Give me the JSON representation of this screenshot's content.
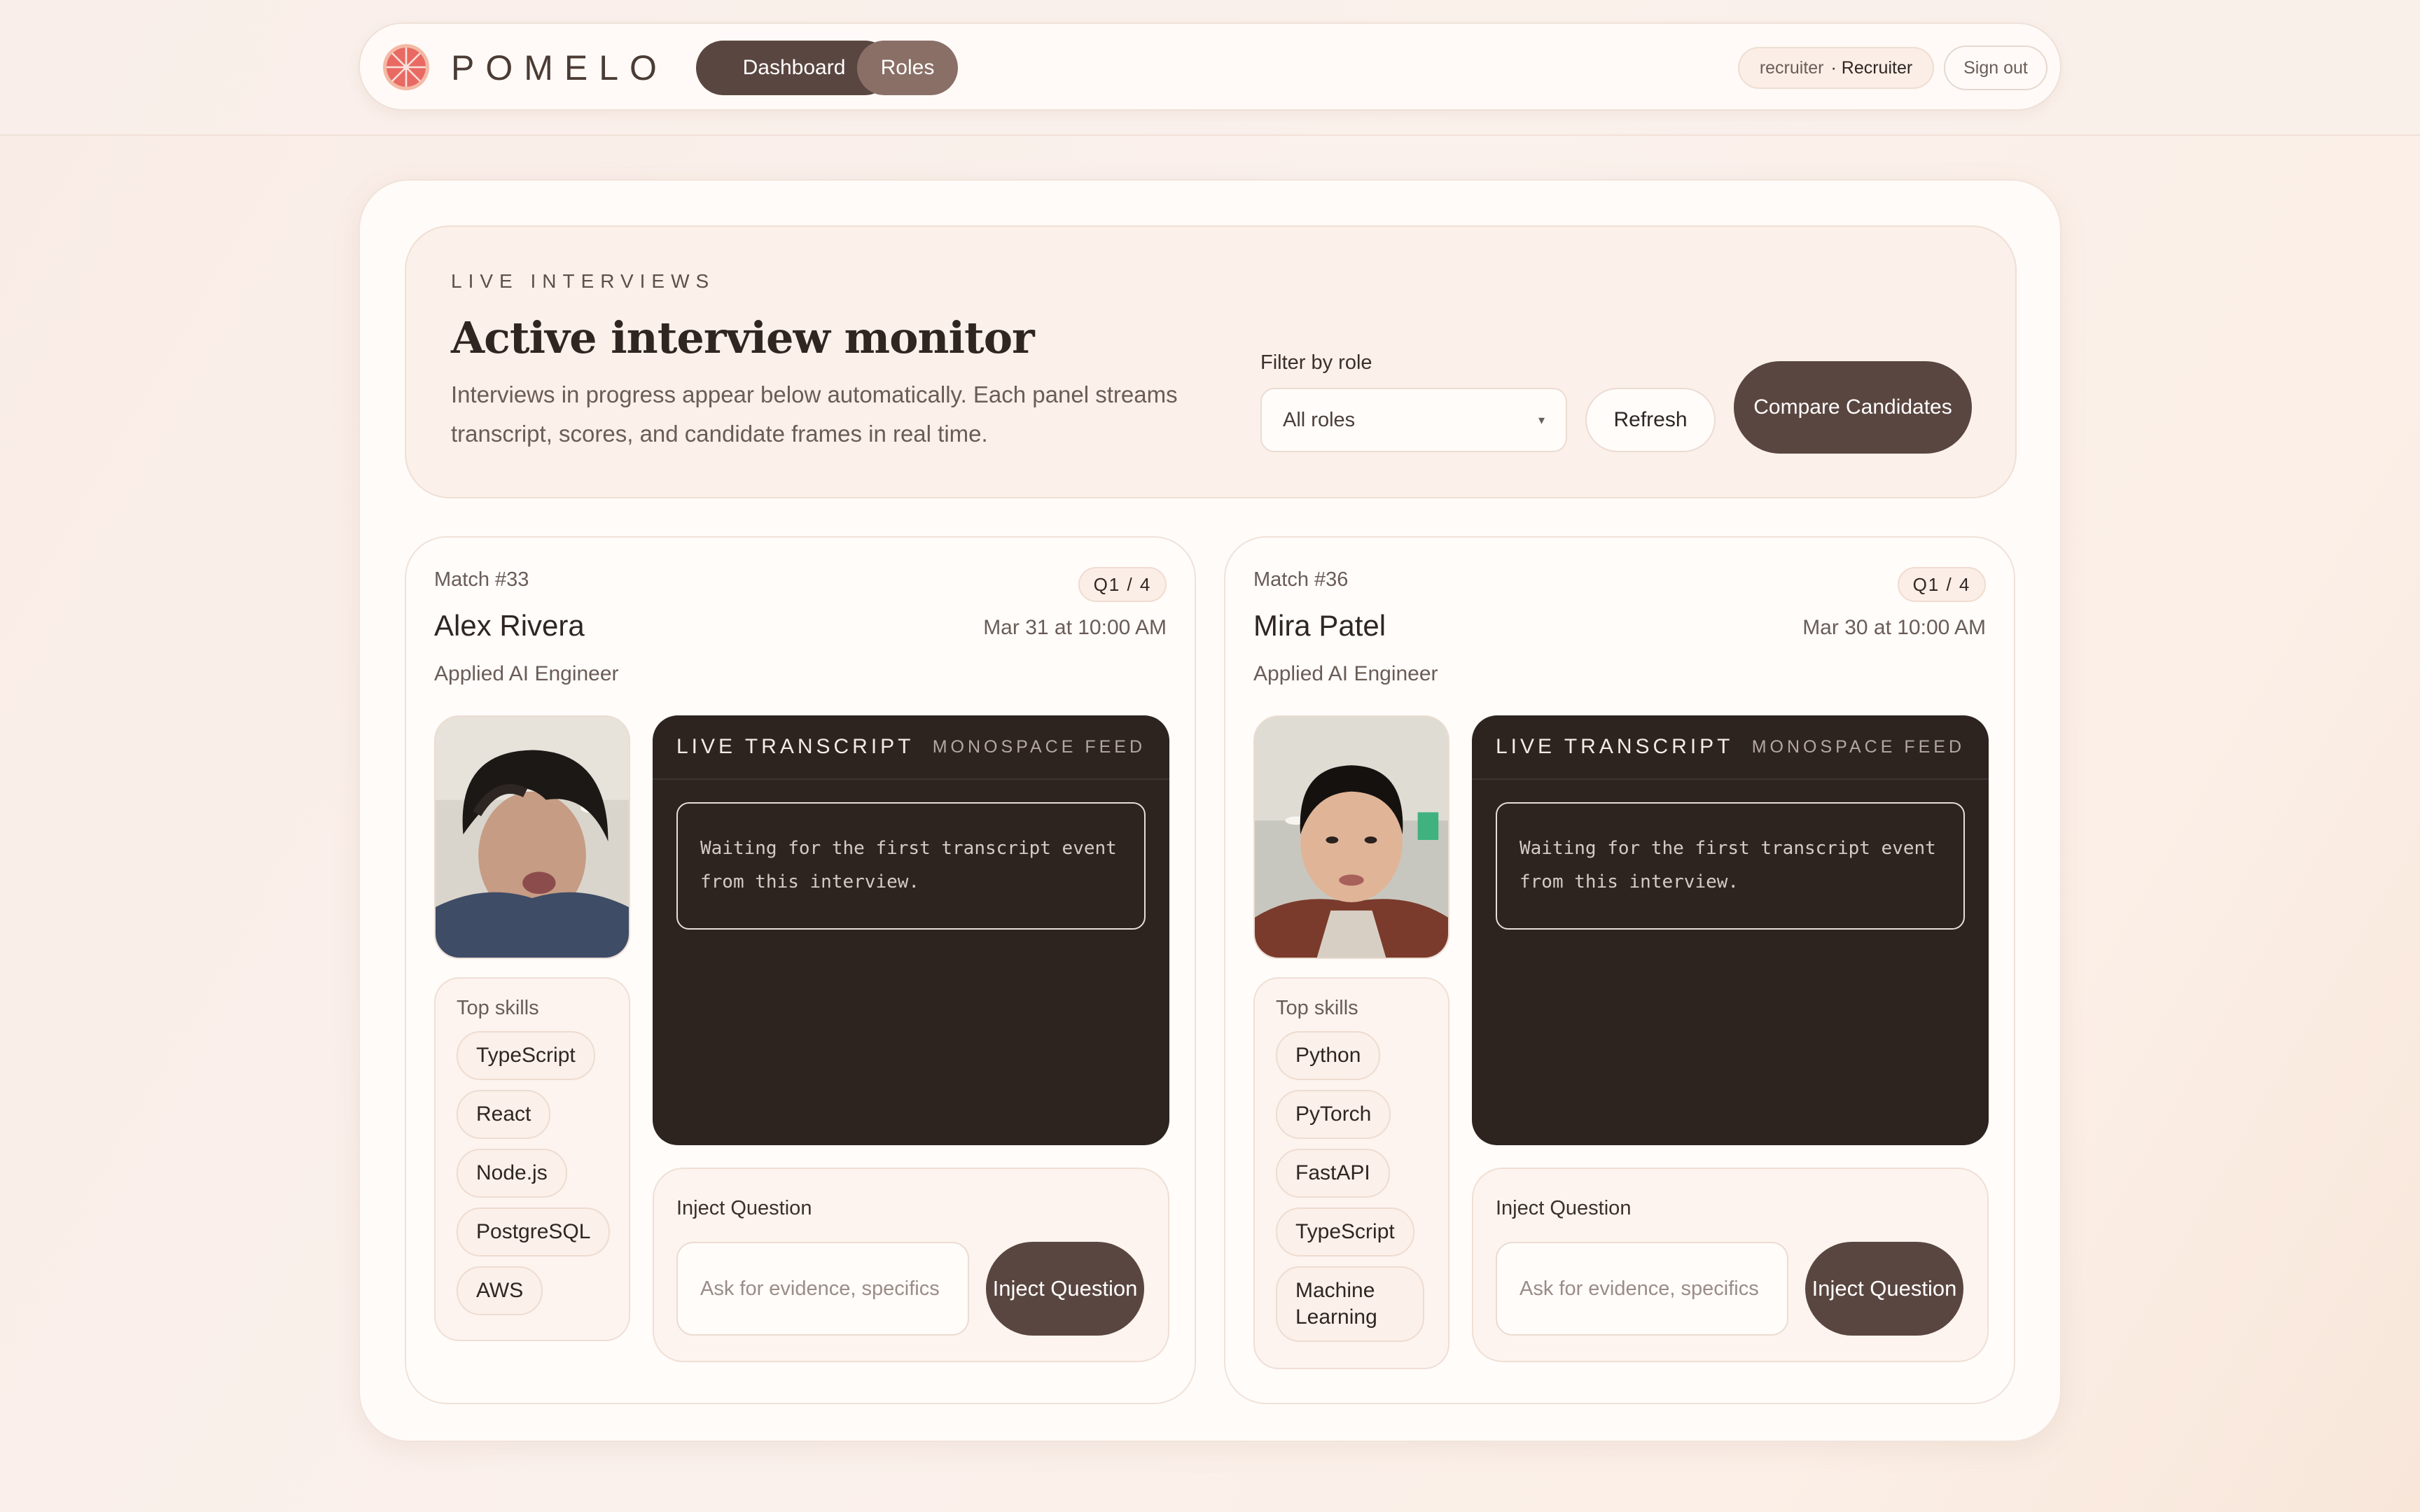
{
  "header": {
    "brand": "POMELO",
    "nav": {
      "dashboard": "Dashboard",
      "roles": "Roles"
    },
    "user": {
      "username": "recruiter",
      "role": "· Recruiter"
    },
    "signout": "Sign out",
    "icons": {
      "logo": "grapefruit-logo"
    },
    "colors": {
      "accent": "#5a4640",
      "accent_light": "#8a6f66",
      "logo": "#e86a63"
    }
  },
  "hero": {
    "eyebrow": "LIVE INTERVIEWS",
    "title": "Active interview monitor",
    "description": "Interviews in progress appear below automatically. Each panel streams transcript, scores, and candidate frames in real time.",
    "filter_label": "Filter by role",
    "filter_value": "All roles",
    "refresh": "Refresh",
    "compare": "Compare Candidates"
  },
  "cards": [
    {
      "match": "Match #33",
      "question": "Q1 / 4",
      "name": "Alex Rivera",
      "date": "Mar 31 at 10:00 AM",
      "role": "Applied AI Engineer",
      "skills_title": "Top skills",
      "skills": [
        "TypeScript",
        "React",
        "Node.js",
        "PostgreSQL",
        "AWS"
      ],
      "transcript_title": "LIVE TRANSCRIPT",
      "transcript_sub": "MONOSPACE FEED",
      "transcript_text": "Waiting for the first transcript event from this interview.",
      "inject_title": "Inject Question",
      "inject_placeholder": "Ask for evidence, specifics",
      "inject_button": "Inject Question"
    },
    {
      "match": "Match #36",
      "question": "Q1 / 4",
      "name": "Mira Patel",
      "date": "Mar 30 at 10:00 AM",
      "role": "Applied AI Engineer",
      "skills_title": "Top skills",
      "skills": [
        "Python",
        "PyTorch",
        "FastAPI",
        "TypeScript",
        "Machine Learning"
      ],
      "transcript_title": "LIVE TRANSCRIPT",
      "transcript_sub": "MONOSPACE FEED",
      "transcript_text": "Waiting for the first transcript event from this interview.",
      "inject_title": "Inject Question",
      "inject_placeholder": "Ask for evidence, specifics",
      "inject_button": "Inject Question"
    }
  ]
}
